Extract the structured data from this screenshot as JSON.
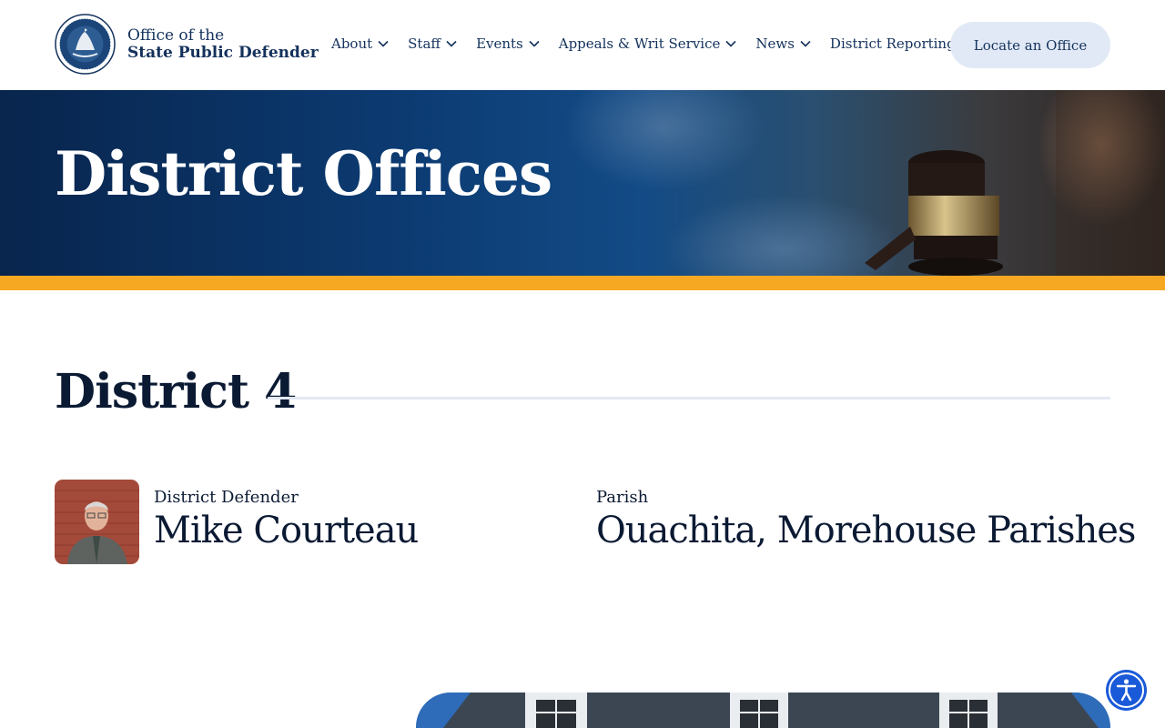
{
  "header": {
    "logo_line1": "Office of the",
    "logo_line2": "State Public Defender",
    "nav": [
      {
        "label": "About",
        "has_dropdown": true
      },
      {
        "label": "Staff",
        "has_dropdown": true
      },
      {
        "label": "Events",
        "has_dropdown": true
      },
      {
        "label": "Appeals & Writ Service",
        "has_dropdown": true
      },
      {
        "label": "News",
        "has_dropdown": true
      },
      {
        "label": "District Reporting",
        "has_dropdown": false
      }
    ],
    "cta_label": "Locate an Office"
  },
  "hero": {
    "title": "District Offices"
  },
  "district": {
    "heading": "District 4",
    "defender_label": "District Defender",
    "defender_name": "Mike Courteau",
    "parish_label": "Parish",
    "parish_name": "Ouachita, Morehouse Parishes"
  },
  "colors": {
    "navy": "#13315c",
    "gold": "#f7a823",
    "button_bg": "#e2e9f6",
    "accessibility_blue": "#1a5ad8"
  },
  "icons": {
    "nav_dropdown": "chevron-down-icon",
    "accessibility": "accessibility-icon"
  }
}
